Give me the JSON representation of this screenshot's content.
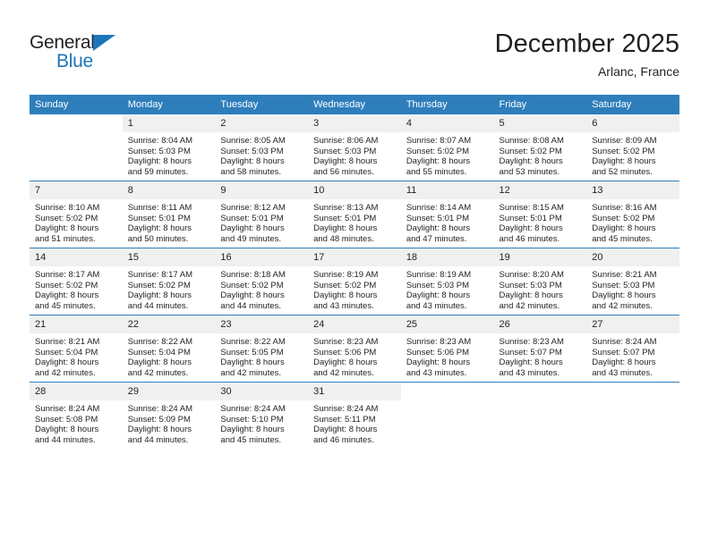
{
  "brand": {
    "name_top": "General",
    "name_bottom": "Blue",
    "accent_color": "#1b75bb"
  },
  "header": {
    "month_title": "December 2025",
    "location": "Arlanc, France"
  },
  "theme": {
    "header_bg": "#2e7ebb",
    "header_text": "#ffffff",
    "daynum_bg": "#f0f0f0",
    "text_color": "#231f20"
  },
  "weekday_headers": [
    "Sunday",
    "Monday",
    "Tuesday",
    "Wednesday",
    "Thursday",
    "Friday",
    "Saturday"
  ],
  "weeks": [
    [
      {
        "day": "",
        "sunrise": "",
        "sunset": "",
        "daylight_line1": "",
        "daylight_line2": "",
        "blank": true
      },
      {
        "day": "1",
        "sunrise": "Sunrise: 8:04 AM",
        "sunset": "Sunset: 5:03 PM",
        "daylight_line1": "Daylight: 8 hours",
        "daylight_line2": "and 59 minutes."
      },
      {
        "day": "2",
        "sunrise": "Sunrise: 8:05 AM",
        "sunset": "Sunset: 5:03 PM",
        "daylight_line1": "Daylight: 8 hours",
        "daylight_line2": "and 58 minutes."
      },
      {
        "day": "3",
        "sunrise": "Sunrise: 8:06 AM",
        "sunset": "Sunset: 5:03 PM",
        "daylight_line1": "Daylight: 8 hours",
        "daylight_line2": "and 56 minutes."
      },
      {
        "day": "4",
        "sunrise": "Sunrise: 8:07 AM",
        "sunset": "Sunset: 5:02 PM",
        "daylight_line1": "Daylight: 8 hours",
        "daylight_line2": "and 55 minutes."
      },
      {
        "day": "5",
        "sunrise": "Sunrise: 8:08 AM",
        "sunset": "Sunset: 5:02 PM",
        "daylight_line1": "Daylight: 8 hours",
        "daylight_line2": "and 53 minutes."
      },
      {
        "day": "6",
        "sunrise": "Sunrise: 8:09 AM",
        "sunset": "Sunset: 5:02 PM",
        "daylight_line1": "Daylight: 8 hours",
        "daylight_line2": "and 52 minutes."
      }
    ],
    [
      {
        "day": "7",
        "sunrise": "Sunrise: 8:10 AM",
        "sunset": "Sunset: 5:02 PM",
        "daylight_line1": "Daylight: 8 hours",
        "daylight_line2": "and 51 minutes."
      },
      {
        "day": "8",
        "sunrise": "Sunrise: 8:11 AM",
        "sunset": "Sunset: 5:01 PM",
        "daylight_line1": "Daylight: 8 hours",
        "daylight_line2": "and 50 minutes."
      },
      {
        "day": "9",
        "sunrise": "Sunrise: 8:12 AM",
        "sunset": "Sunset: 5:01 PM",
        "daylight_line1": "Daylight: 8 hours",
        "daylight_line2": "and 49 minutes."
      },
      {
        "day": "10",
        "sunrise": "Sunrise: 8:13 AM",
        "sunset": "Sunset: 5:01 PM",
        "daylight_line1": "Daylight: 8 hours",
        "daylight_line2": "and 48 minutes."
      },
      {
        "day": "11",
        "sunrise": "Sunrise: 8:14 AM",
        "sunset": "Sunset: 5:01 PM",
        "daylight_line1": "Daylight: 8 hours",
        "daylight_line2": "and 47 minutes."
      },
      {
        "day": "12",
        "sunrise": "Sunrise: 8:15 AM",
        "sunset": "Sunset: 5:01 PM",
        "daylight_line1": "Daylight: 8 hours",
        "daylight_line2": "and 46 minutes."
      },
      {
        "day": "13",
        "sunrise": "Sunrise: 8:16 AM",
        "sunset": "Sunset: 5:02 PM",
        "daylight_line1": "Daylight: 8 hours",
        "daylight_line2": "and 45 minutes."
      }
    ],
    [
      {
        "day": "14",
        "sunrise": "Sunrise: 8:17 AM",
        "sunset": "Sunset: 5:02 PM",
        "daylight_line1": "Daylight: 8 hours",
        "daylight_line2": "and 45 minutes."
      },
      {
        "day": "15",
        "sunrise": "Sunrise: 8:17 AM",
        "sunset": "Sunset: 5:02 PM",
        "daylight_line1": "Daylight: 8 hours",
        "daylight_line2": "and 44 minutes."
      },
      {
        "day": "16",
        "sunrise": "Sunrise: 8:18 AM",
        "sunset": "Sunset: 5:02 PM",
        "daylight_line1": "Daylight: 8 hours",
        "daylight_line2": "and 44 minutes."
      },
      {
        "day": "17",
        "sunrise": "Sunrise: 8:19 AM",
        "sunset": "Sunset: 5:02 PM",
        "daylight_line1": "Daylight: 8 hours",
        "daylight_line2": "and 43 minutes."
      },
      {
        "day": "18",
        "sunrise": "Sunrise: 8:19 AM",
        "sunset": "Sunset: 5:03 PM",
        "daylight_line1": "Daylight: 8 hours",
        "daylight_line2": "and 43 minutes."
      },
      {
        "day": "19",
        "sunrise": "Sunrise: 8:20 AM",
        "sunset": "Sunset: 5:03 PM",
        "daylight_line1": "Daylight: 8 hours",
        "daylight_line2": "and 42 minutes."
      },
      {
        "day": "20",
        "sunrise": "Sunrise: 8:21 AM",
        "sunset": "Sunset: 5:03 PM",
        "daylight_line1": "Daylight: 8 hours",
        "daylight_line2": "and 42 minutes."
      }
    ],
    [
      {
        "day": "21",
        "sunrise": "Sunrise: 8:21 AM",
        "sunset": "Sunset: 5:04 PM",
        "daylight_line1": "Daylight: 8 hours",
        "daylight_line2": "and 42 minutes."
      },
      {
        "day": "22",
        "sunrise": "Sunrise: 8:22 AM",
        "sunset": "Sunset: 5:04 PM",
        "daylight_line1": "Daylight: 8 hours",
        "daylight_line2": "and 42 minutes."
      },
      {
        "day": "23",
        "sunrise": "Sunrise: 8:22 AM",
        "sunset": "Sunset: 5:05 PM",
        "daylight_line1": "Daylight: 8 hours",
        "daylight_line2": "and 42 minutes."
      },
      {
        "day": "24",
        "sunrise": "Sunrise: 8:23 AM",
        "sunset": "Sunset: 5:06 PM",
        "daylight_line1": "Daylight: 8 hours",
        "daylight_line2": "and 42 minutes."
      },
      {
        "day": "25",
        "sunrise": "Sunrise: 8:23 AM",
        "sunset": "Sunset: 5:06 PM",
        "daylight_line1": "Daylight: 8 hours",
        "daylight_line2": "and 43 minutes."
      },
      {
        "day": "26",
        "sunrise": "Sunrise: 8:23 AM",
        "sunset": "Sunset: 5:07 PM",
        "daylight_line1": "Daylight: 8 hours",
        "daylight_line2": "and 43 minutes."
      },
      {
        "day": "27",
        "sunrise": "Sunrise: 8:24 AM",
        "sunset": "Sunset: 5:07 PM",
        "daylight_line1": "Daylight: 8 hours",
        "daylight_line2": "and 43 minutes."
      }
    ],
    [
      {
        "day": "28",
        "sunrise": "Sunrise: 8:24 AM",
        "sunset": "Sunset: 5:08 PM",
        "daylight_line1": "Daylight: 8 hours",
        "daylight_line2": "and 44 minutes."
      },
      {
        "day": "29",
        "sunrise": "Sunrise: 8:24 AM",
        "sunset": "Sunset: 5:09 PM",
        "daylight_line1": "Daylight: 8 hours",
        "daylight_line2": "and 44 minutes."
      },
      {
        "day": "30",
        "sunrise": "Sunrise: 8:24 AM",
        "sunset": "Sunset: 5:10 PM",
        "daylight_line1": "Daylight: 8 hours",
        "daylight_line2": "and 45 minutes."
      },
      {
        "day": "31",
        "sunrise": "Sunrise: 8:24 AM",
        "sunset": "Sunset: 5:11 PM",
        "daylight_line1": "Daylight: 8 hours",
        "daylight_line2": "and 46 minutes."
      },
      {
        "day": "",
        "sunrise": "",
        "sunset": "",
        "daylight_line1": "",
        "daylight_line2": "",
        "blank": true
      },
      {
        "day": "",
        "sunrise": "",
        "sunset": "",
        "daylight_line1": "",
        "daylight_line2": "",
        "blank": true
      },
      {
        "day": "",
        "sunrise": "",
        "sunset": "",
        "daylight_line1": "",
        "daylight_line2": "",
        "blank": true
      }
    ]
  ]
}
